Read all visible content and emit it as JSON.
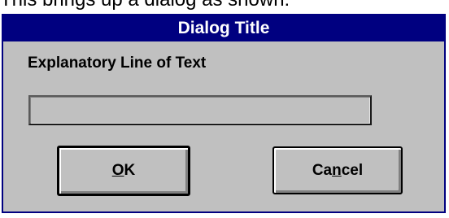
{
  "caption": {
    "text": "This brings up a dialog as shown:"
  },
  "dialog": {
    "title": "Dialog Title",
    "explanatory_text": "Explanatory Line of Text",
    "input": {
      "value": "",
      "placeholder": ""
    },
    "buttons": {
      "ok_label": "OK",
      "ok_mnemonic": "O",
      "ok_rest": "K",
      "cancel_label": "Cancel",
      "cancel_prefix": "Ca",
      "cancel_mnemonic": "n",
      "cancel_suffix": "cel"
    }
  },
  "colors": {
    "titlebar": "#000080",
    "dialog_face": "#c0c0c0",
    "title_text": "#ffffff"
  }
}
